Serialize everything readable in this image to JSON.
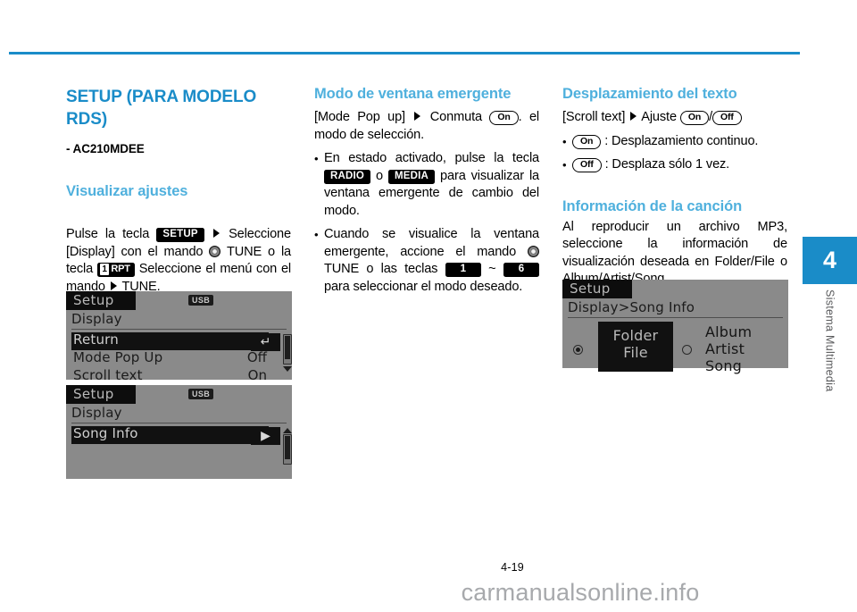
{
  "page": {
    "number": "4-19",
    "watermark": "carmanualsonline.info",
    "chapter_number": "4",
    "chapter_label": "Sistema Multimedia",
    "accent_color": "#1a8cc8",
    "subheading_color": "#4fb0dd"
  },
  "col1": {
    "title": "SETUP (PARA MODELO RDS)",
    "model_code": "- AC210MDEE",
    "subtitle": "Visualizar ajustes",
    "instruction": {
      "t1": "Pulse la tecla",
      "badge_setup": "SETUP",
      "t2": "Seleccione [Display] con el mando",
      "t3": "TUNE o la tecla",
      "badge_rpt_key": "1",
      "badge_rpt_text": "RPT",
      "t4": "Seleccione el menú con el mando",
      "t5": "TUNE."
    }
  },
  "col2": {
    "title": "Modo de ventana emergente",
    "intro": {
      "t1": "[Mode Pop up]",
      "t2": "Conmuta",
      "pill_on": "On",
      "t3": ". el modo de selección."
    },
    "bullets": [
      {
        "t1": "En estado activado, pulse la tecla",
        "badge_radio": "RADIO",
        "t2": "o",
        "badge_media": "MEDIA",
        "t3": "para visualizar la ventana emergente de cambio del modo."
      },
      {
        "t1": "Cuando se visualice la ventana emergente, accione el mando",
        "t2": "TUNE o las teclas",
        "badge_1": "1",
        "tilde": "~",
        "badge_6": "6",
        "t3": "para seleccionar el modo deseado."
      }
    ]
  },
  "col3": {
    "title": "Desplazamiento del texto",
    "intro": {
      "t1": "[Scroll text]",
      "t2": "Ajuste",
      "pill_on": "On",
      "slash": "/",
      "pill_off": "Off"
    },
    "bullets": [
      {
        "pill": "On",
        "text": ": Desplazamiento continuo."
      },
      {
        "pill": "Off",
        "text": ": Desplaza sólo 1 vez."
      }
    ],
    "title2": "Información de la canción",
    "body2": "Al reproducir un archivo MP3, seleccione la información de visualización deseada en Folder/File o Album/Artist/Song."
  },
  "lcd1": {
    "title": "Setup",
    "usb_badge": "USB",
    "breadcrumb": "Display",
    "rows": [
      {
        "label": "Return",
        "value": "",
        "selected": true,
        "value_icon": "return-arrow-icon"
      },
      {
        "label": "Mode Pop Up",
        "value": "Off",
        "selected": false
      },
      {
        "label": "Scroll text",
        "value": "On",
        "selected": false
      }
    ]
  },
  "lcd2": {
    "title": "Setup",
    "usb_badge": "USB",
    "breadcrumb": "Display",
    "rows": [
      {
        "label": "Song Info",
        "value": "",
        "selected": true,
        "value_icon": "chevron-right-icon"
      }
    ]
  },
  "lcd3": {
    "title": "Setup",
    "breadcrumb": "Display>Song Info",
    "choice_selected": {
      "line1": "Folder",
      "line2": "File"
    },
    "choice_other": {
      "line1": "Album",
      "line2": "Artist",
      "line3": "Song"
    }
  }
}
